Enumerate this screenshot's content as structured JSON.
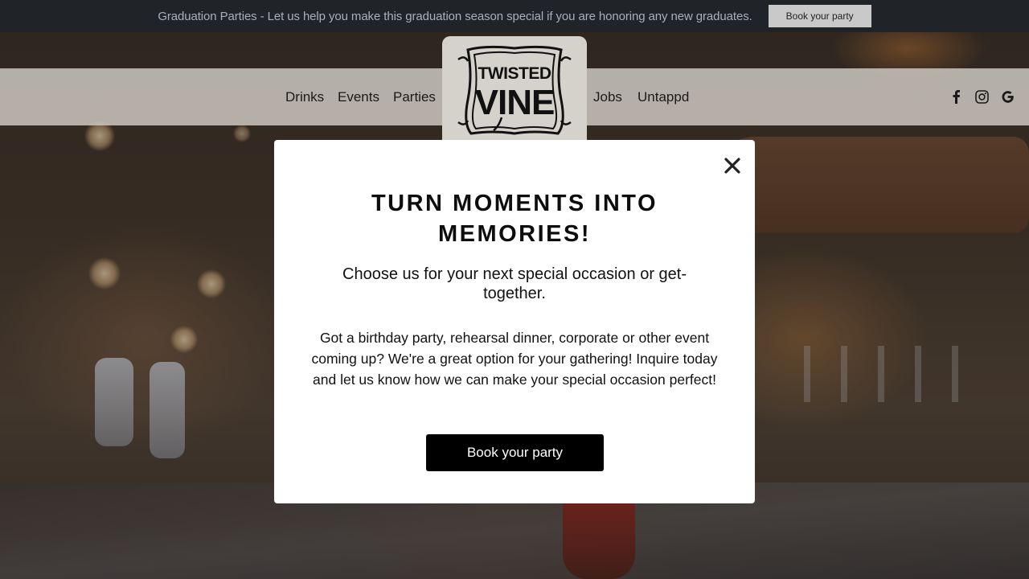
{
  "announcement": {
    "text": "Graduation Parties - Let us help you make this graduation season special if you are honoring any new graduates.",
    "button_label": "Book your party"
  },
  "nav": {
    "left_links": [
      "Drinks",
      "Events",
      "Parties"
    ],
    "right_links": [
      "Jobs",
      "Untappd"
    ],
    "social": [
      "facebook-icon",
      "instagram-icon",
      "google-icon"
    ]
  },
  "logo": {
    "line1": "TWISTED",
    "line2": "VINE"
  },
  "modal": {
    "title": "TURN MOMENTS INTO MEMORIES!",
    "subtitle": "Choose us for your next special occasion or get-together.",
    "body": "Got a birthday party, rehearsal dinner, corporate or other event coming up? We're a great option for your gathering! Inquire today and let us know how we can make your special occasion perfect!",
    "cta_label": "Book your party",
    "close_icon": "close-icon"
  },
  "colors": {
    "announcement_bg": "#202328",
    "nav_bg": "#d2cdc6",
    "cta_bg": "#000000",
    "modal_bg": "#ffffff"
  }
}
